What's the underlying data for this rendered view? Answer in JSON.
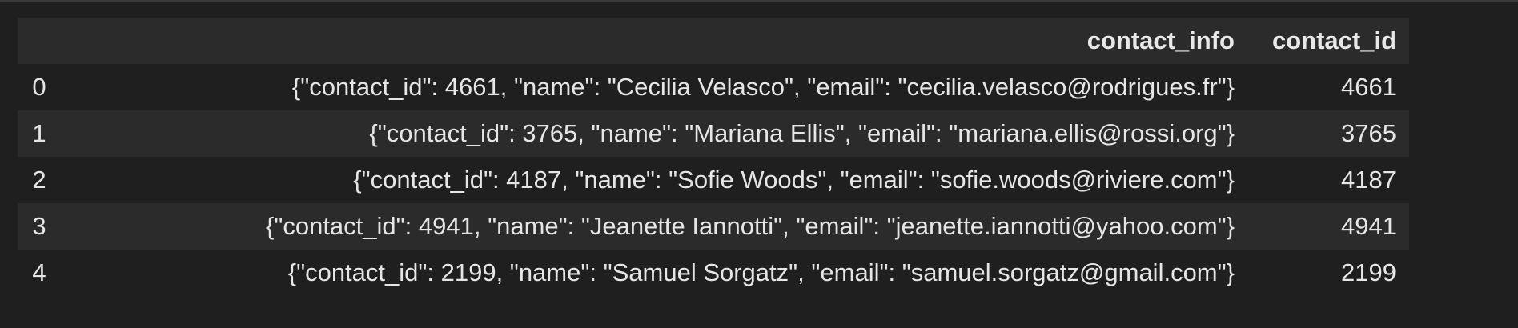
{
  "table": {
    "columns": [
      "",
      "contact_info",
      "contact_id"
    ],
    "rows": [
      {
        "index": "0",
        "contact_info": "{\"contact_id\": 4661, \"name\": \"Cecilia Velasco\", \"email\": \"cecilia.velasco@rodrigues.fr\"}",
        "contact_id": "4661"
      },
      {
        "index": "1",
        "contact_info": "{\"contact_id\": 3765, \"name\": \"Mariana Ellis\", \"email\": \"mariana.ellis@rossi.org\"}",
        "contact_id": "3765"
      },
      {
        "index": "2",
        "contact_info": "{\"contact_id\": 4187, \"name\": \"Sofie Woods\", \"email\": \"sofie.woods@riviere.com\"}",
        "contact_id": "4187"
      },
      {
        "index": "3",
        "contact_info": "{\"contact_id\": 4941, \"name\": \"Jeanette Iannotti\", \"email\": \"jeanette.iannotti@yahoo.com\"}",
        "contact_id": "4941"
      },
      {
        "index": "4",
        "contact_info": "{\"contact_id\": 2199, \"name\": \"Samuel Sorgatz\", \"email\": \"samuel.sorgatz@gmail.com\"}",
        "contact_id": "2199"
      }
    ]
  },
  "colors": {
    "background": "#1f1f1f",
    "header_background": "#2b2b2b",
    "striped_row": "#2b2b2b",
    "text": "#e6e6e6"
  }
}
